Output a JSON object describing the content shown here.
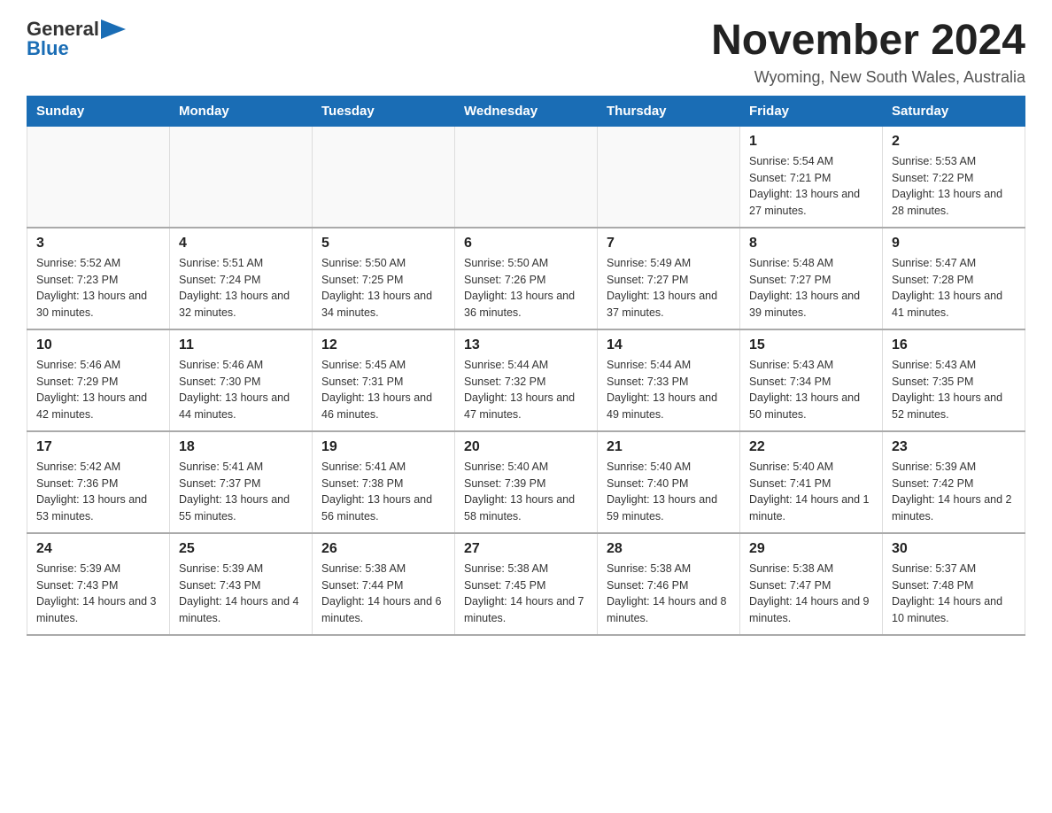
{
  "header": {
    "logo_general": "General",
    "logo_blue": "Blue",
    "month_title": "November 2024",
    "location": "Wyoming, New South Wales, Australia"
  },
  "days_of_week": [
    "Sunday",
    "Monday",
    "Tuesday",
    "Wednesday",
    "Thursday",
    "Friday",
    "Saturday"
  ],
  "weeks": [
    [
      {
        "day": "",
        "info": ""
      },
      {
        "day": "",
        "info": ""
      },
      {
        "day": "",
        "info": ""
      },
      {
        "day": "",
        "info": ""
      },
      {
        "day": "",
        "info": ""
      },
      {
        "day": "1",
        "info": "Sunrise: 5:54 AM\nSunset: 7:21 PM\nDaylight: 13 hours and 27 minutes."
      },
      {
        "day": "2",
        "info": "Sunrise: 5:53 AM\nSunset: 7:22 PM\nDaylight: 13 hours and 28 minutes."
      }
    ],
    [
      {
        "day": "3",
        "info": "Sunrise: 5:52 AM\nSunset: 7:23 PM\nDaylight: 13 hours and 30 minutes."
      },
      {
        "day": "4",
        "info": "Sunrise: 5:51 AM\nSunset: 7:24 PM\nDaylight: 13 hours and 32 minutes."
      },
      {
        "day": "5",
        "info": "Sunrise: 5:50 AM\nSunset: 7:25 PM\nDaylight: 13 hours and 34 minutes."
      },
      {
        "day": "6",
        "info": "Sunrise: 5:50 AM\nSunset: 7:26 PM\nDaylight: 13 hours and 36 minutes."
      },
      {
        "day": "7",
        "info": "Sunrise: 5:49 AM\nSunset: 7:27 PM\nDaylight: 13 hours and 37 minutes."
      },
      {
        "day": "8",
        "info": "Sunrise: 5:48 AM\nSunset: 7:27 PM\nDaylight: 13 hours and 39 minutes."
      },
      {
        "day": "9",
        "info": "Sunrise: 5:47 AM\nSunset: 7:28 PM\nDaylight: 13 hours and 41 minutes."
      }
    ],
    [
      {
        "day": "10",
        "info": "Sunrise: 5:46 AM\nSunset: 7:29 PM\nDaylight: 13 hours and 42 minutes."
      },
      {
        "day": "11",
        "info": "Sunrise: 5:46 AM\nSunset: 7:30 PM\nDaylight: 13 hours and 44 minutes."
      },
      {
        "day": "12",
        "info": "Sunrise: 5:45 AM\nSunset: 7:31 PM\nDaylight: 13 hours and 46 minutes."
      },
      {
        "day": "13",
        "info": "Sunrise: 5:44 AM\nSunset: 7:32 PM\nDaylight: 13 hours and 47 minutes."
      },
      {
        "day": "14",
        "info": "Sunrise: 5:44 AM\nSunset: 7:33 PM\nDaylight: 13 hours and 49 minutes."
      },
      {
        "day": "15",
        "info": "Sunrise: 5:43 AM\nSunset: 7:34 PM\nDaylight: 13 hours and 50 minutes."
      },
      {
        "day": "16",
        "info": "Sunrise: 5:43 AM\nSunset: 7:35 PM\nDaylight: 13 hours and 52 minutes."
      }
    ],
    [
      {
        "day": "17",
        "info": "Sunrise: 5:42 AM\nSunset: 7:36 PM\nDaylight: 13 hours and 53 minutes."
      },
      {
        "day": "18",
        "info": "Sunrise: 5:41 AM\nSunset: 7:37 PM\nDaylight: 13 hours and 55 minutes."
      },
      {
        "day": "19",
        "info": "Sunrise: 5:41 AM\nSunset: 7:38 PM\nDaylight: 13 hours and 56 minutes."
      },
      {
        "day": "20",
        "info": "Sunrise: 5:40 AM\nSunset: 7:39 PM\nDaylight: 13 hours and 58 minutes."
      },
      {
        "day": "21",
        "info": "Sunrise: 5:40 AM\nSunset: 7:40 PM\nDaylight: 13 hours and 59 minutes."
      },
      {
        "day": "22",
        "info": "Sunrise: 5:40 AM\nSunset: 7:41 PM\nDaylight: 14 hours and 1 minute."
      },
      {
        "day": "23",
        "info": "Sunrise: 5:39 AM\nSunset: 7:42 PM\nDaylight: 14 hours and 2 minutes."
      }
    ],
    [
      {
        "day": "24",
        "info": "Sunrise: 5:39 AM\nSunset: 7:43 PM\nDaylight: 14 hours and 3 minutes."
      },
      {
        "day": "25",
        "info": "Sunrise: 5:39 AM\nSunset: 7:43 PM\nDaylight: 14 hours and 4 minutes."
      },
      {
        "day": "26",
        "info": "Sunrise: 5:38 AM\nSunset: 7:44 PM\nDaylight: 14 hours and 6 minutes."
      },
      {
        "day": "27",
        "info": "Sunrise: 5:38 AM\nSunset: 7:45 PM\nDaylight: 14 hours and 7 minutes."
      },
      {
        "day": "28",
        "info": "Sunrise: 5:38 AM\nSunset: 7:46 PM\nDaylight: 14 hours and 8 minutes."
      },
      {
        "day": "29",
        "info": "Sunrise: 5:38 AM\nSunset: 7:47 PM\nDaylight: 14 hours and 9 minutes."
      },
      {
        "day": "30",
        "info": "Sunrise: 5:37 AM\nSunset: 7:48 PM\nDaylight: 14 hours and 10 minutes."
      }
    ]
  ]
}
